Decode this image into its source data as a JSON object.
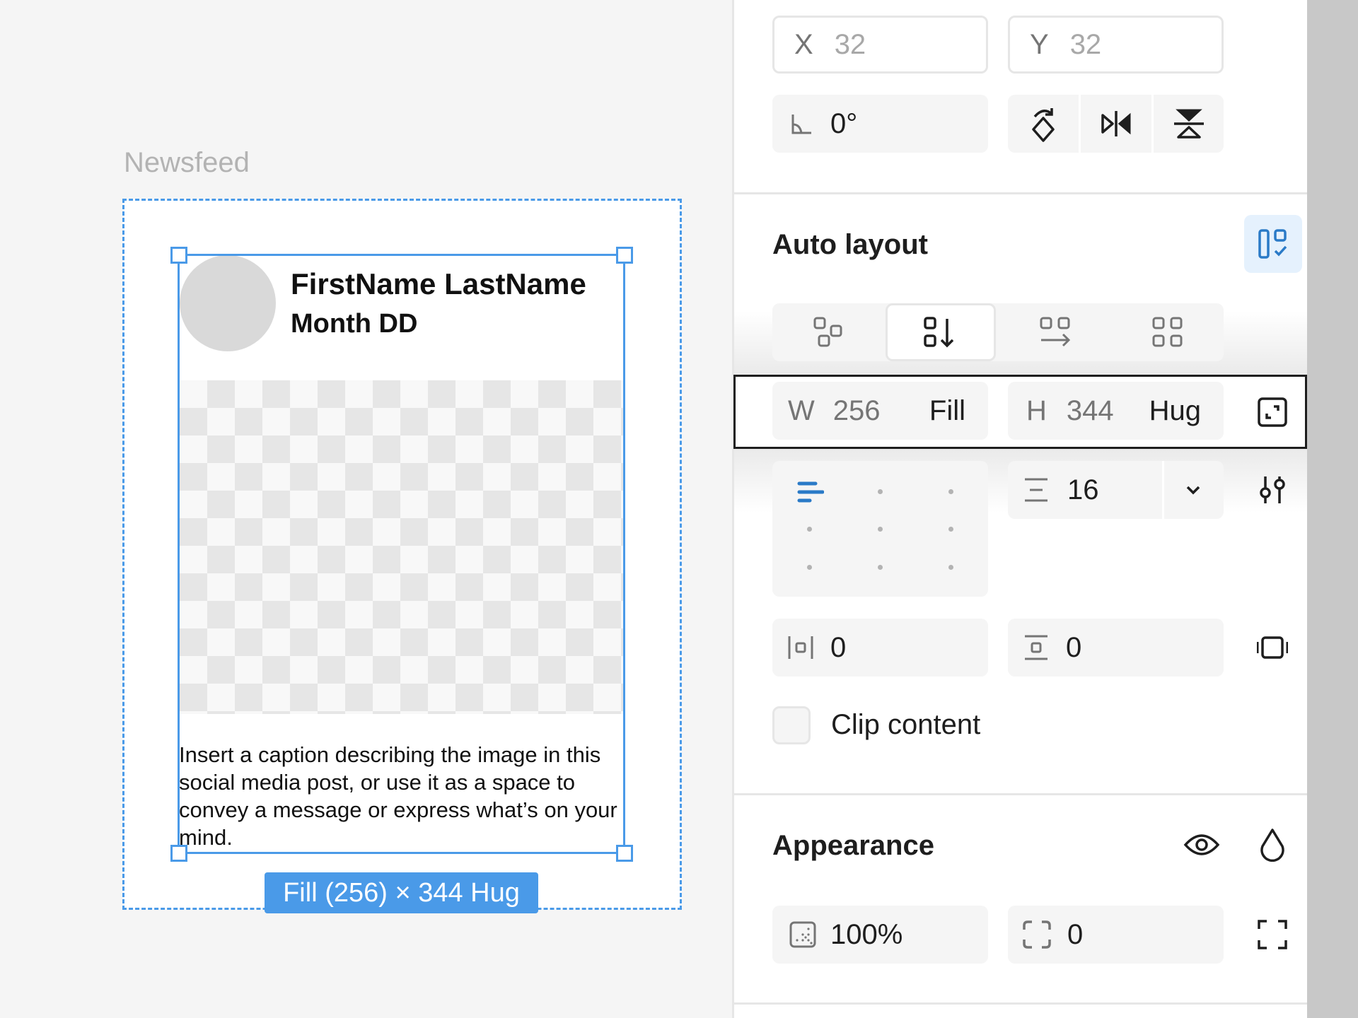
{
  "canvas": {
    "frame_label": "Newsfeed",
    "post": {
      "name": "FirstName LastName",
      "date": "Month DD",
      "caption": "Insert a caption describing the image in this social media post, or use it as a space to convey a message or express what’s on your mind."
    },
    "selection_badge": "Fill (256) × 344 Hug"
  },
  "panel": {
    "position": {
      "x_label": "X",
      "x_value": "32",
      "y_label": "Y",
      "y_value": "32",
      "rotation_value": "0°"
    },
    "auto_layout": {
      "title": "Auto layout",
      "direction_options": [
        "freeform",
        "vertical",
        "horizontal",
        "grid"
      ],
      "direction_selected": "vertical",
      "width_label": "W",
      "width_value": "256",
      "width_mode": "Fill",
      "height_label": "H",
      "height_value": "344",
      "height_mode": "Hug",
      "gap_value": "16",
      "padding_horizontal": "0",
      "padding_vertical": "0",
      "clip_content_label": "Clip content",
      "clip_content_checked": false
    },
    "appearance": {
      "title": "Appearance",
      "opacity_value": "100%",
      "corner_radius_value": "0"
    }
  },
  "colors": {
    "selection": "#4a9ae8",
    "panel_field": "#f5f5f5",
    "panel_bg": "#ffffff",
    "canvas_bg": "#f5f5f5"
  }
}
